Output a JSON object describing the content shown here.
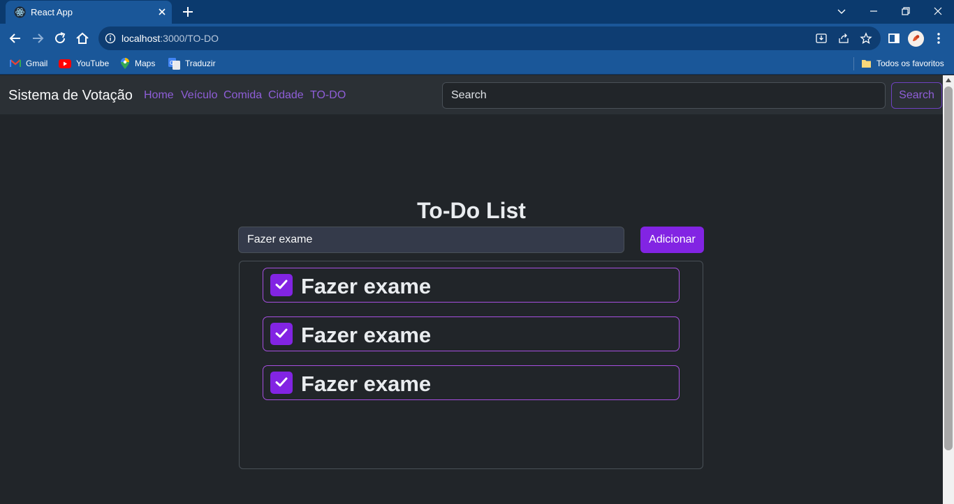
{
  "browser": {
    "tab_title": "React App",
    "url_host": "localhost",
    "url_path": ":3000/TO-DO",
    "bookmarks": [
      {
        "label": "Gmail",
        "icon": "gmail-icon"
      },
      {
        "label": "YouTube",
        "icon": "youtube-icon"
      },
      {
        "label": "Maps",
        "icon": "maps-icon"
      },
      {
        "label": "Traduzir",
        "icon": "translate-icon"
      }
    ],
    "favorites_folder": "Todos os favoritos"
  },
  "navbar": {
    "brand": "Sistema de Votação",
    "links": [
      "Home",
      "Veículo",
      "Comida",
      "Cidade",
      "TO-DO"
    ],
    "search_placeholder": "Search",
    "search_button": "Search"
  },
  "todo": {
    "title": "To-Do List",
    "input_value": "Fazer exame",
    "add_button": "Adicionar",
    "items": [
      {
        "text": "Fazer exame",
        "checked": true
      },
      {
        "text": "Fazer exame",
        "checked": true
      },
      {
        "text": "Fazer exame",
        "checked": true
      }
    ]
  },
  "colors": {
    "accent": "#8224e3",
    "link": "#8f5ed8",
    "background": "#212529",
    "navbar": "#2b3035",
    "browser_frame": "#1a5799"
  }
}
